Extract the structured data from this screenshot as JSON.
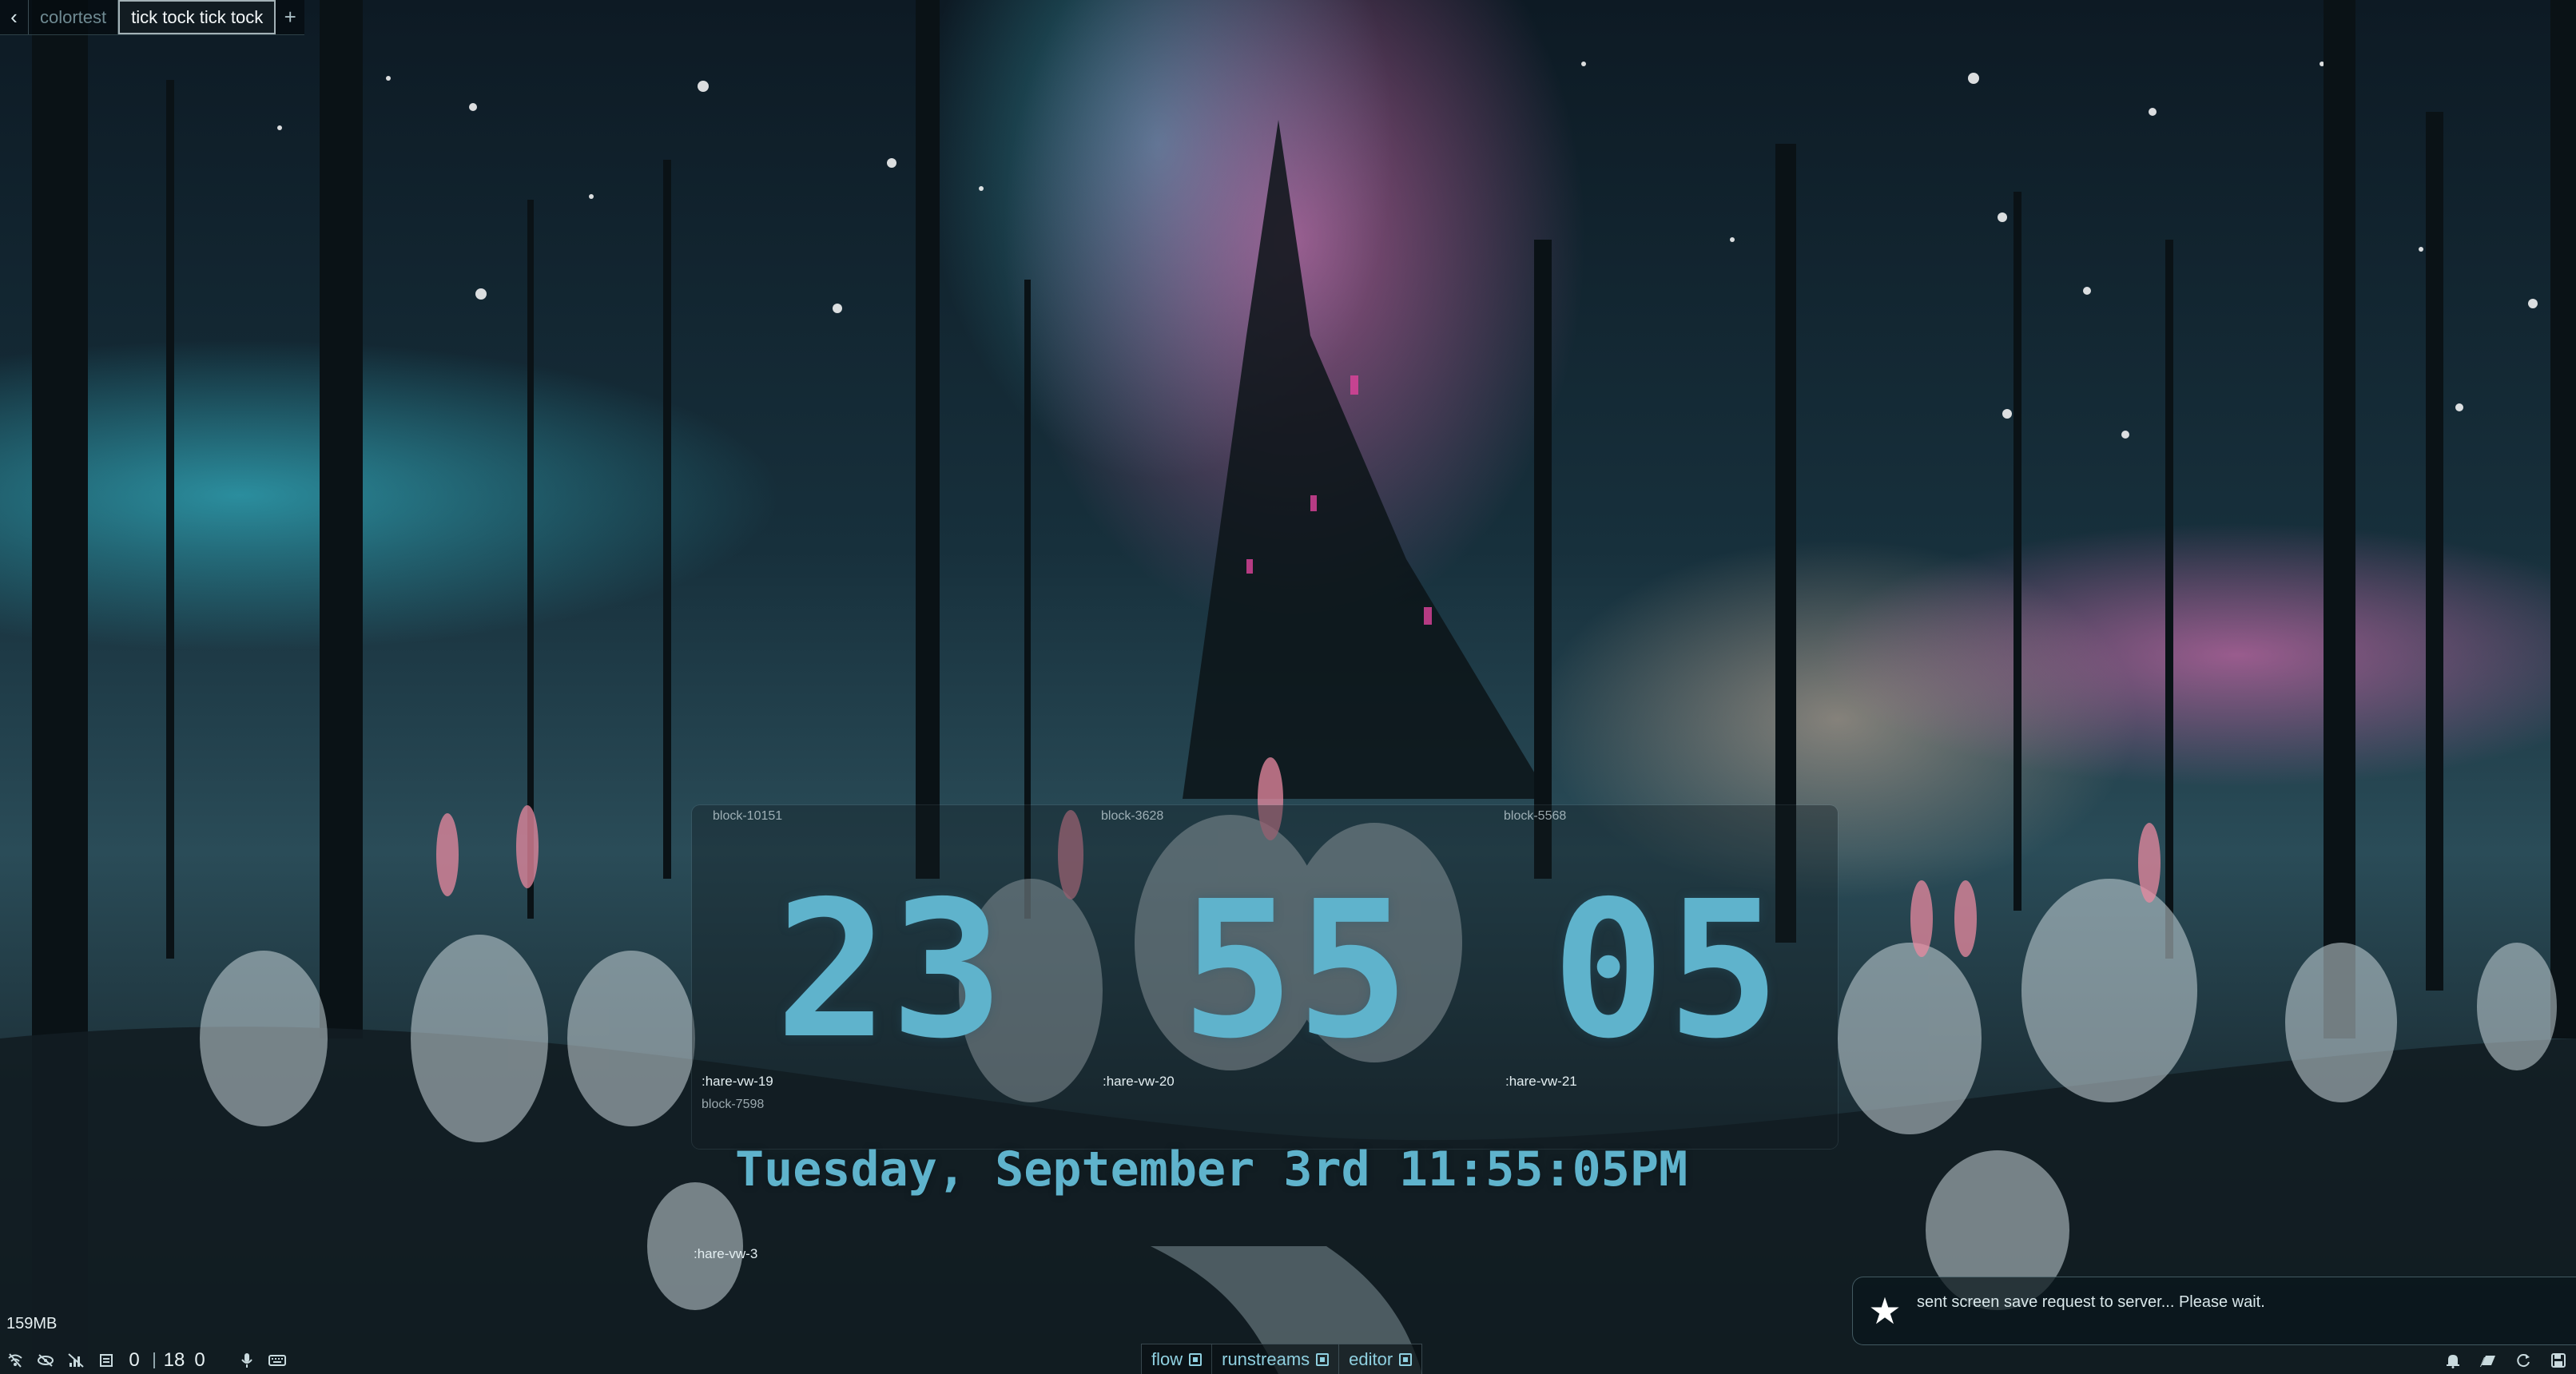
{
  "tabs": {
    "back": "‹",
    "items": [
      {
        "label": "colortest",
        "active": false
      },
      {
        "label": "tick tock tick tock",
        "active": true
      }
    ],
    "add": "+"
  },
  "clock": {
    "blocks": {
      "hours_block": "block-10151",
      "minutes_block": "block-3628",
      "seconds_block": "block-5568",
      "date_block": "block-7598"
    },
    "hares": {
      "hours": ":hare-vw-19",
      "minutes": ":hare-vw-20",
      "seconds": ":hare-vw-21",
      "outside": ":hare-vw-3"
    },
    "hours": "23",
    "minutes": "55",
    "seconds": "05",
    "date_line": "Tuesday, September 3rd 11:55:05PM",
    "color": "#5fb3cc"
  },
  "memory": "159MB",
  "status_left": {
    "icons": [
      "wifi-off-icon",
      "eye-off-icon",
      "signal-off-icon",
      "server-icon"
    ],
    "counts": [
      "0",
      "18",
      "0"
    ],
    "icons_after": [
      "mic-icon",
      "keyboard-icon"
    ]
  },
  "workspaces": [
    {
      "label": "flow"
    },
    {
      "label": "runstreams"
    },
    {
      "label": "editor"
    }
  ],
  "toast": {
    "icon": "star-icon",
    "message": "sent screen save request to server... Please wait."
  },
  "status_right": {
    "icons": [
      "bell-icon",
      "layers-icon",
      "refresh-icon",
      "save-icon"
    ]
  }
}
